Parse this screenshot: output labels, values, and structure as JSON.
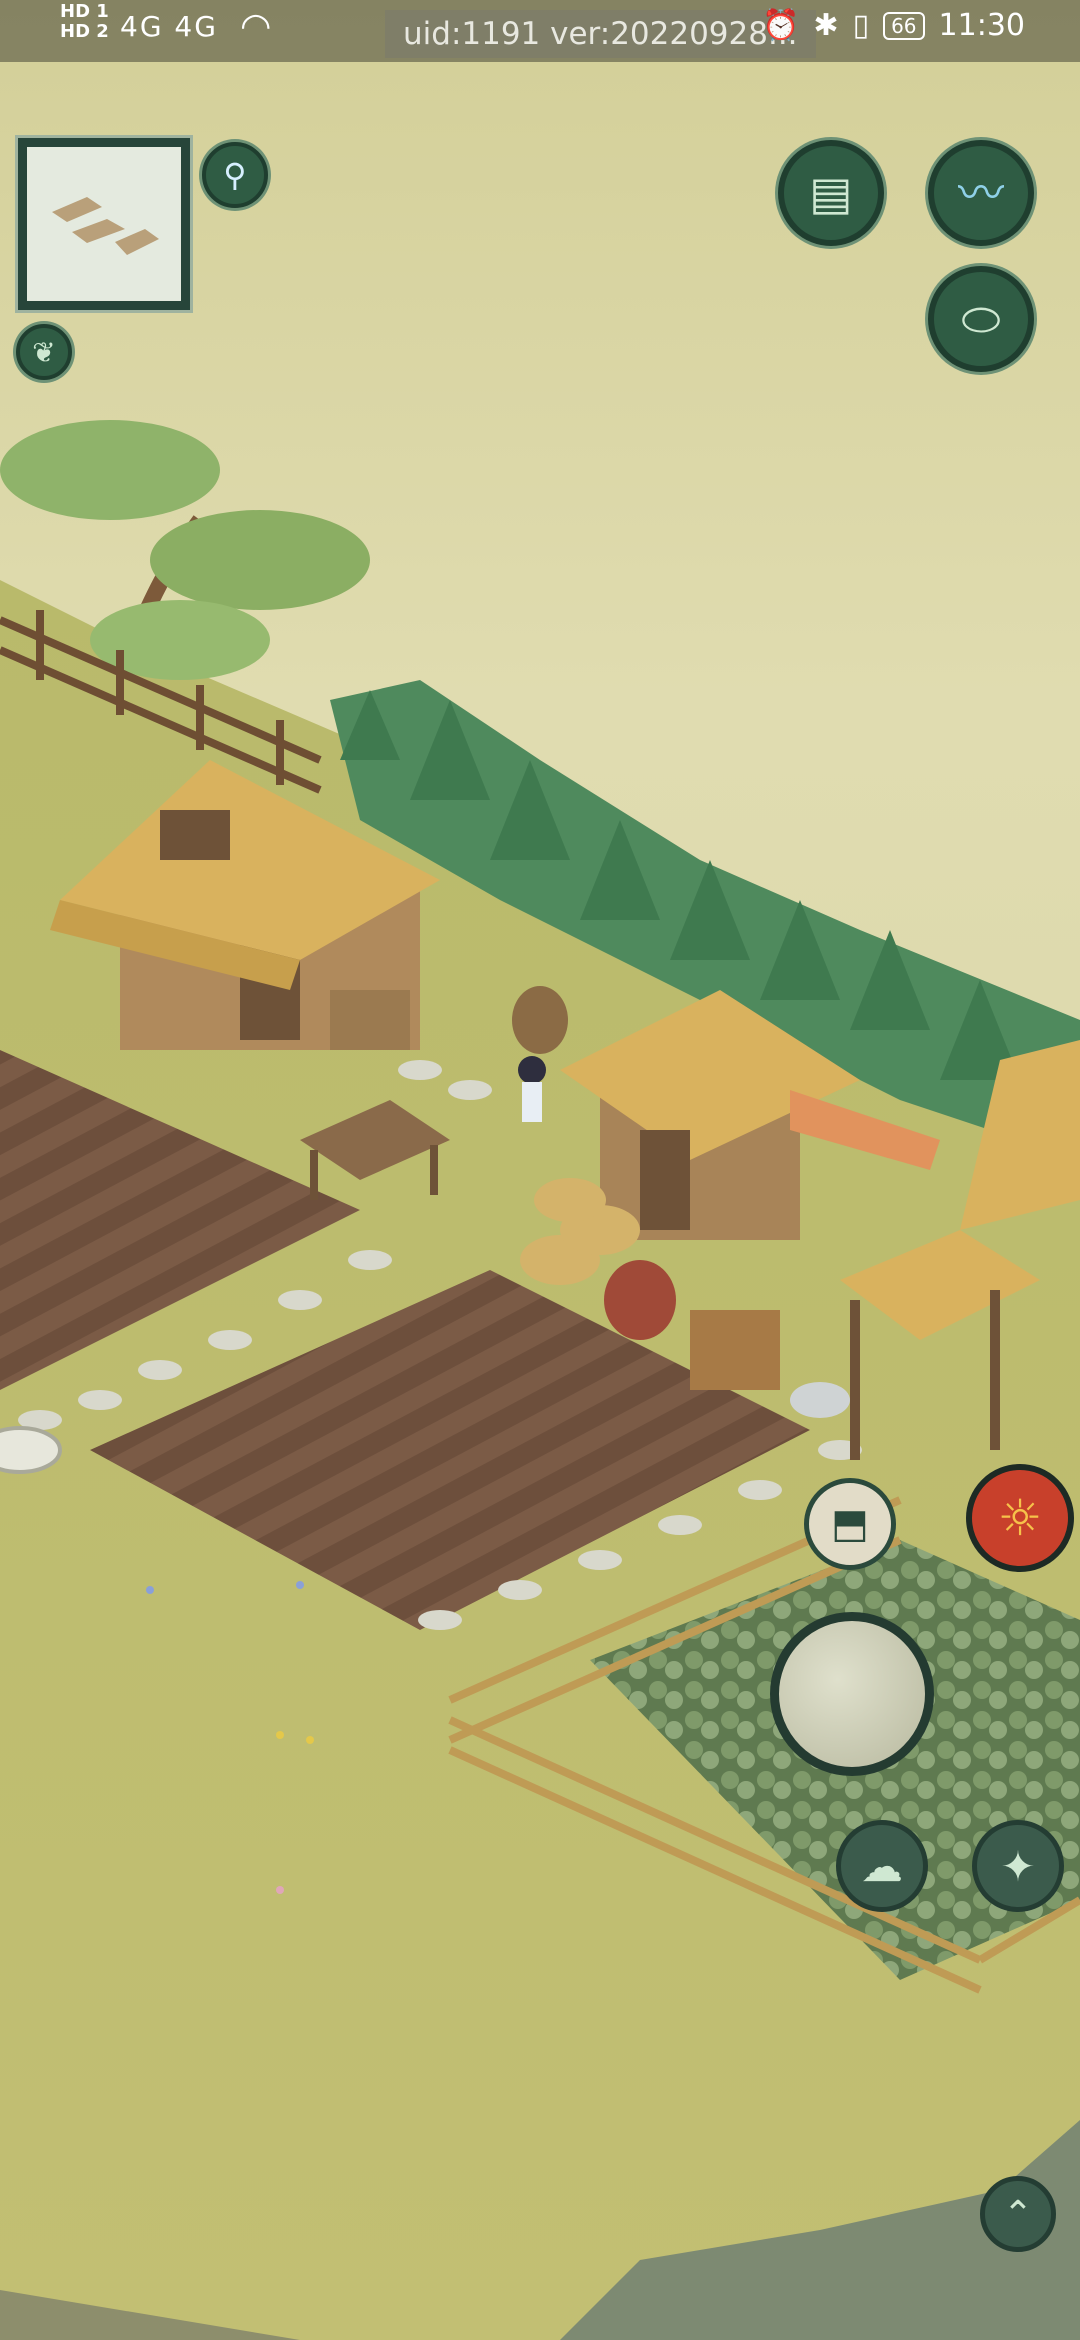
{
  "status_bar": {
    "sim_labels": [
      "HD 1",
      "HD 2"
    ],
    "network": "4G 4G",
    "wifi_icon": "wifi-icon",
    "uid_text": "uid:1191 ver:20220928...",
    "battery": "66",
    "time": "11:30",
    "icons": [
      "alarm-icon",
      "bluetooth-icon",
      "vibrate-icon",
      "battery-icon"
    ]
  },
  "hud": {
    "minimap_icon": "minimap-icon",
    "location_pin_icon": "location-pin-icon",
    "leaf_button_icon": "leaf-icon",
    "scroll_button_icon": "scroll-icon",
    "wave_button_icon": "wave-icon",
    "jar_button_icon": "jar-icon",
    "crate_button_icon": "crate-icon",
    "hero_avatar_icon": "hero-avatar-icon",
    "joystick_icon": "joystick-icon",
    "cloud_skill_icon": "cloud-skill-icon",
    "diamond_skill_icon": "diamond-skill-icon",
    "up_arrow_icon": "up-arrow-icon"
  },
  "colors": {
    "sky": "#d8d4a0",
    "grass": "#b7b864",
    "soil": "#7a5a45",
    "button_green": "#2f5c44"
  }
}
